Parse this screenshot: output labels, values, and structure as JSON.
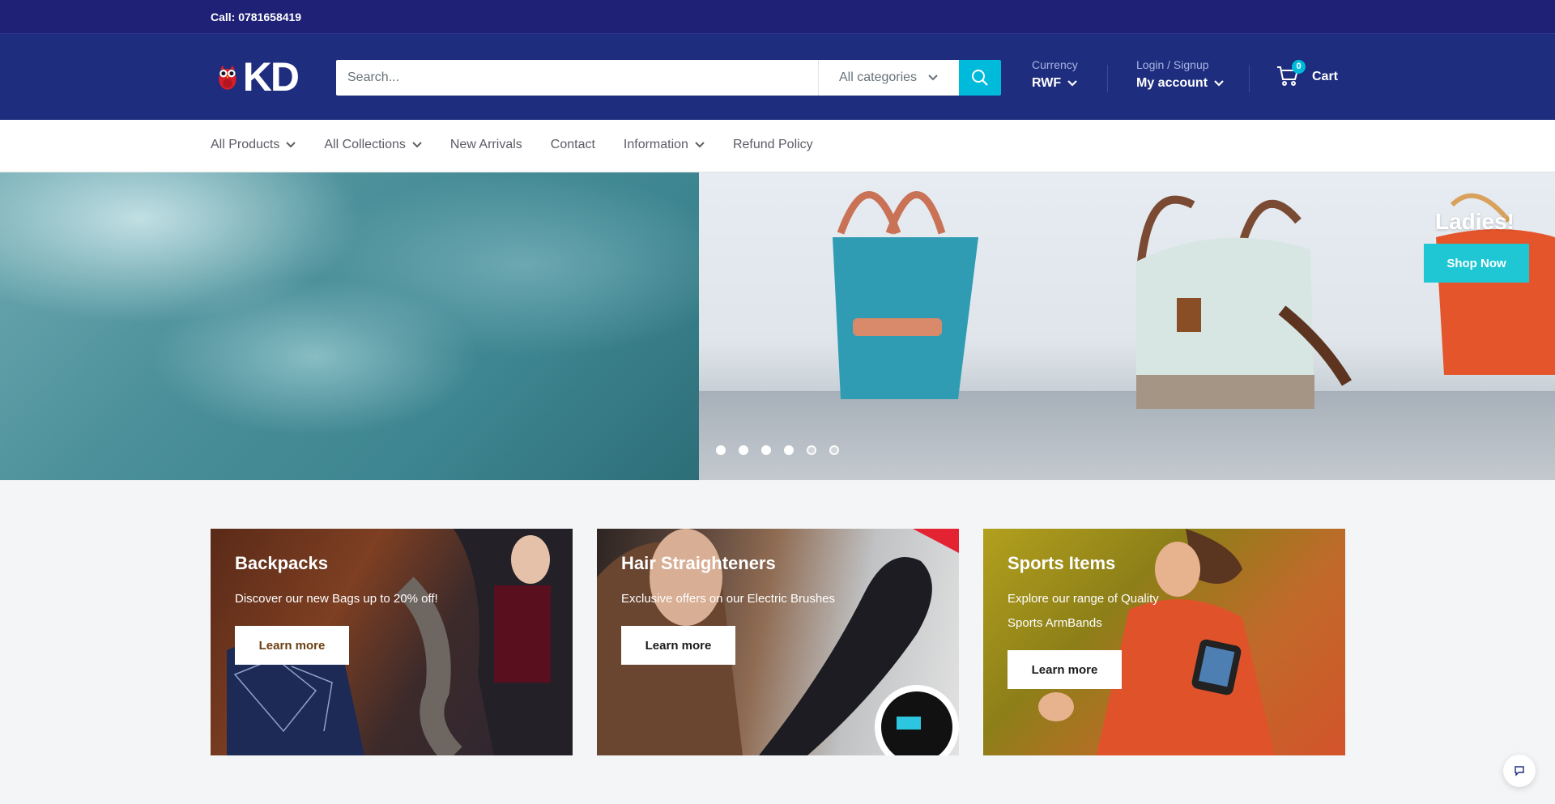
{
  "topbar": {
    "phone": "Call: 0781658419"
  },
  "header": {
    "logo_text": "KD",
    "search": {
      "placeholder": "Search...",
      "category": "All categories"
    },
    "currency": {
      "label": "Currency",
      "value": "RWF"
    },
    "account": {
      "label": "Login / Signup",
      "value": "My account"
    },
    "cart": {
      "count": "0",
      "label": "Cart"
    }
  },
  "nav": {
    "items": [
      {
        "label": "All Products",
        "dropdown": true
      },
      {
        "label": "All Collections",
        "dropdown": true
      },
      {
        "label": "New Arrivals",
        "dropdown": false
      },
      {
        "label": "Contact",
        "dropdown": false
      },
      {
        "label": "Information",
        "dropdown": true
      },
      {
        "label": "Refund Policy",
        "dropdown": false
      }
    ]
  },
  "hero": {
    "title": "Ladies!",
    "button": "Shop Now",
    "slides": 6,
    "active_slide": 1
  },
  "promos": [
    {
      "title": "Backpacks",
      "text": "Discover our new Bags up to 20% off!",
      "button": "Learn more"
    },
    {
      "title": "Hair Straighteners",
      "text": "Exclusive offers on our Electric Brushes",
      "button": "Learn more"
    },
    {
      "title": "Sports Items",
      "text": "Explore our range of Quality Sports ArmBands",
      "button": "Learn more"
    }
  ],
  "colors": {
    "header": "#1e2d7d",
    "topbar": "#1e2176",
    "accent": "#00badb",
    "button": "#1fc7d4"
  }
}
